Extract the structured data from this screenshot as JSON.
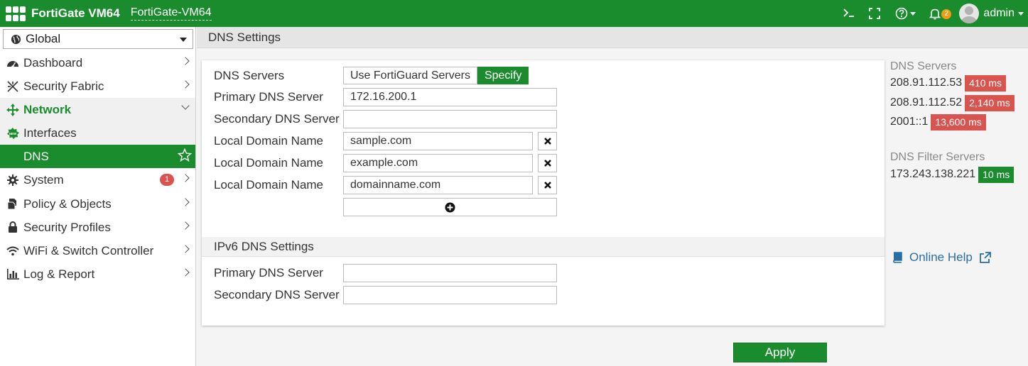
{
  "header": {
    "product": "FortiGate VM64",
    "hostname": "FortiGate-VM64",
    "notification_count": "2",
    "user": "admin"
  },
  "sidebar": {
    "vdom": "Global",
    "items": [
      {
        "label": "Dashboard",
        "icon": "dashboard-icon"
      },
      {
        "label": "Security Fabric",
        "icon": "security-fabric-icon"
      },
      {
        "label": "Network",
        "icon": "network-icon",
        "expanded": true
      },
      {
        "label": "Interfaces",
        "icon": "new-badge-icon"
      },
      {
        "label": "DNS",
        "icon": "",
        "active": true
      },
      {
        "label": "System",
        "icon": "gear-icon",
        "badge": "1"
      },
      {
        "label": "Policy & Objects",
        "icon": "policy-icon"
      },
      {
        "label": "Security Profiles",
        "icon": "lock-icon"
      },
      {
        "label": "WiFi & Switch Controller",
        "icon": "wifi-icon"
      },
      {
        "label": "Log & Report",
        "icon": "bar-chart-icon"
      }
    ]
  },
  "page": {
    "title": "DNS Settings"
  },
  "form": {
    "dns_servers_label": "DNS Servers",
    "dns_options": [
      "Use FortiGuard Servers",
      "Specify"
    ],
    "dns_selected": "Specify",
    "primary_label": "Primary DNS Server",
    "primary_value": "172.16.200.1",
    "secondary_label": "Secondary DNS Server",
    "secondary_value": "",
    "local_domain_label": "Local Domain Name",
    "local_domains": [
      "sample.com",
      "example.com",
      "domainname.com"
    ],
    "ipv6_heading": "IPv6 DNS Settings",
    "ipv6_primary_label": "Primary DNS Server",
    "ipv6_primary_value": "",
    "ipv6_secondary_label": "Secondary DNS Server",
    "ipv6_secondary_value": ""
  },
  "side_info": {
    "dns_servers_title": "DNS Servers",
    "dns_servers": [
      {
        "address": "208.91.112.53",
        "latency": "410 ms",
        "status": "bad"
      },
      {
        "address": "208.91.112.52",
        "latency": "2,140 ms",
        "status": "bad"
      },
      {
        "address": "2001::1",
        "latency": "13,600 ms",
        "status": "bad"
      }
    ],
    "filter_title": "DNS Filter Servers",
    "filter_servers": [
      {
        "address": "173.243.138.221",
        "latency": "10 ms",
        "status": "good"
      }
    ],
    "help_label": "Online Help"
  },
  "actions": {
    "apply_label": "Apply"
  },
  "colors": {
    "brand_green": "#1a8c2e",
    "latency_bad": "#d9534f",
    "notification_badge": "#f39c12",
    "link_blue": "#2a6ea6"
  }
}
